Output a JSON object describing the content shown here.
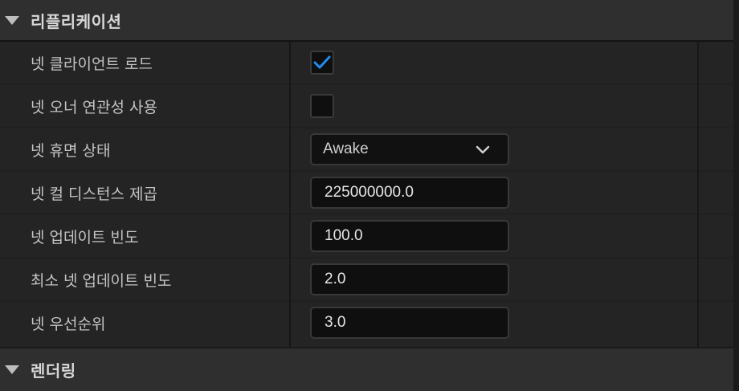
{
  "sections": [
    {
      "title": "리플리케이션",
      "expanded": true
    },
    {
      "title": "렌더링",
      "expanded": true
    }
  ],
  "properties": {
    "net_load_on_client": {
      "label": "넷 클라이언트 로드",
      "checked": true
    },
    "net_use_owner_relevancy": {
      "label": "넷 오너 연관성 사용",
      "checked": false
    },
    "net_dormancy": {
      "label": "넷 휴면 상태",
      "value": "Awake"
    },
    "net_cull_distance_squared": {
      "label": "넷 컬 디스턴스 제곱",
      "value": "225000000.0"
    },
    "net_update_frequency": {
      "label": "넷 업데이트 빈도",
      "value": "100.0"
    },
    "min_net_update_frequency": {
      "label": "최소 넷 업데이트 빈도",
      "value": "2.0"
    },
    "net_priority": {
      "label": "넷 우선순위",
      "value": "3.0"
    }
  },
  "colors": {
    "checkmark": "#1f8ef1",
    "panel_bg": "#242424",
    "header_bg": "#2f2f2f",
    "field_bg": "#0f0f0f"
  }
}
